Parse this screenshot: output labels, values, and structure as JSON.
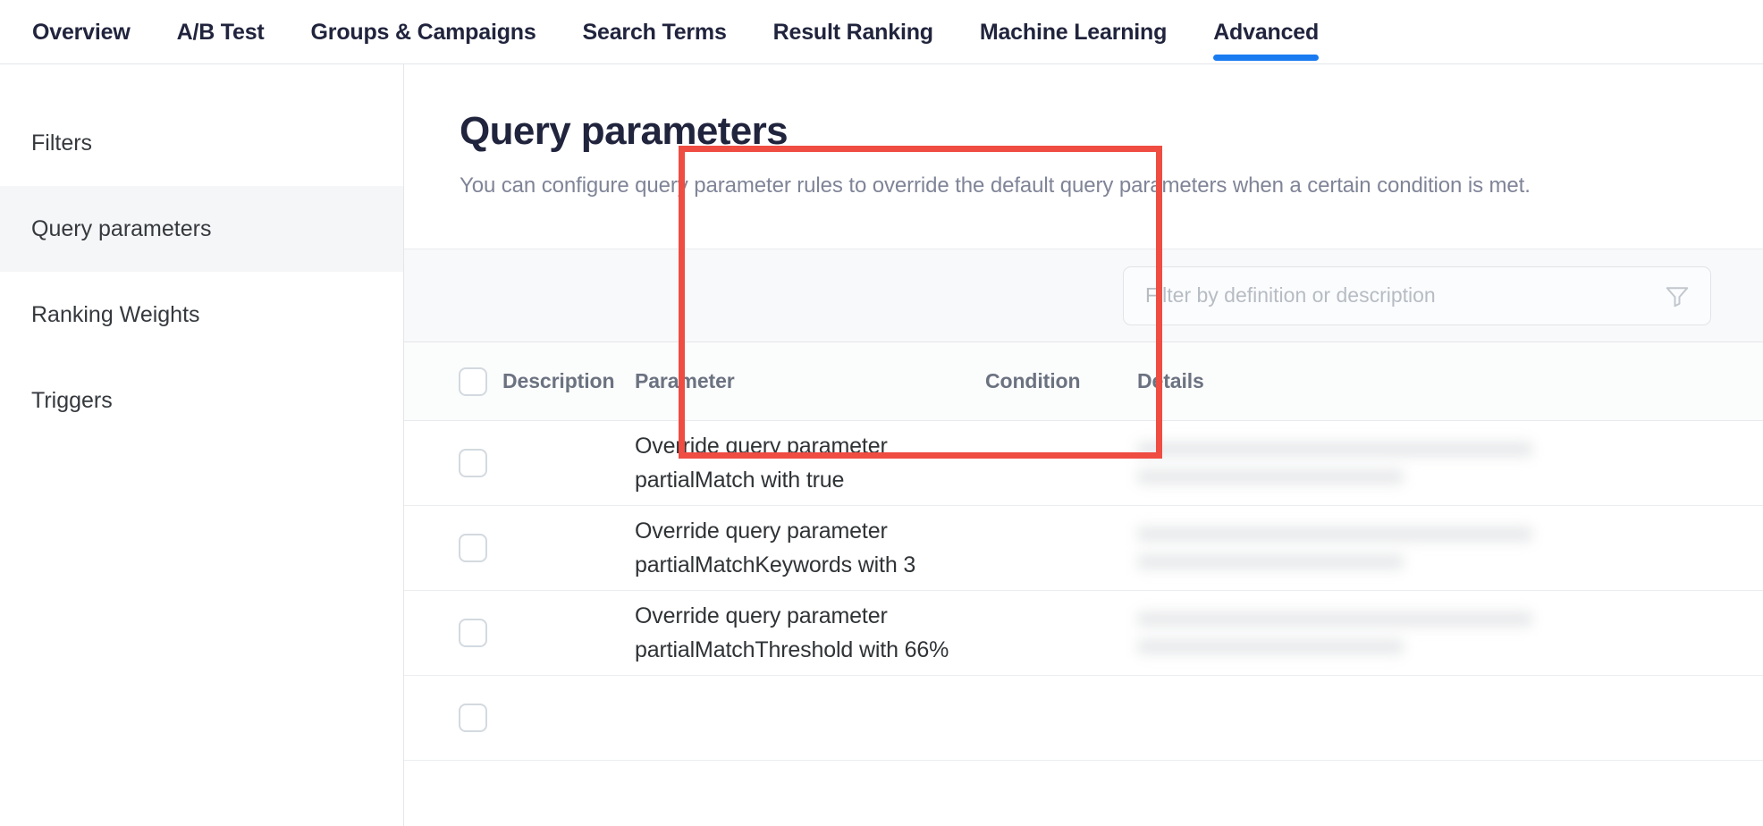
{
  "topnav": {
    "tabs": [
      {
        "label": "Overview",
        "active": false
      },
      {
        "label": "A/B Test",
        "active": false
      },
      {
        "label": "Groups & Campaigns",
        "active": false
      },
      {
        "label": "Search Terms",
        "active": false
      },
      {
        "label": "Result Ranking",
        "active": false
      },
      {
        "label": "Machine Learning",
        "active": false
      },
      {
        "label": "Advanced",
        "active": true
      }
    ],
    "active_accent_color": "#1a7bf0"
  },
  "sidebar": {
    "items": [
      {
        "label": "Filters",
        "active": false
      },
      {
        "label": "Query parameters",
        "active": true
      },
      {
        "label": "Ranking Weights",
        "active": false
      },
      {
        "label": "Triggers",
        "active": false
      }
    ]
  },
  "main": {
    "title": "Query parameters",
    "subtitle": "You can configure query parameter rules to override the default query parameters when a certain condition is met.",
    "toolbar": {
      "filter_value": "",
      "filter_placeholder": "Filter by definition or description",
      "filter_icon": "funnel-icon"
    },
    "table": {
      "columns": [
        "",
        "Description",
        "Parameter",
        "Condition",
        "Details"
      ],
      "rows": [
        {
          "selected": false,
          "description": "",
          "parameter": "Override query parameter partialMatch with true",
          "condition": "",
          "details": "redacted"
        },
        {
          "selected": false,
          "description": "",
          "parameter": "Override query parameter partialMatchKeywords with 3",
          "condition": "",
          "details": "redacted"
        },
        {
          "selected": false,
          "description": "",
          "parameter": "Override query parameter partialMatchThreshold with 66%",
          "condition": "",
          "details": "redacted"
        },
        {
          "selected": false,
          "description": "",
          "parameter": "",
          "condition": "",
          "details": ""
        }
      ]
    },
    "annotation": {
      "type": "highlight-rectangle",
      "color": "#ef4c42",
      "covers": "parameter-column-rows-1-3"
    }
  }
}
